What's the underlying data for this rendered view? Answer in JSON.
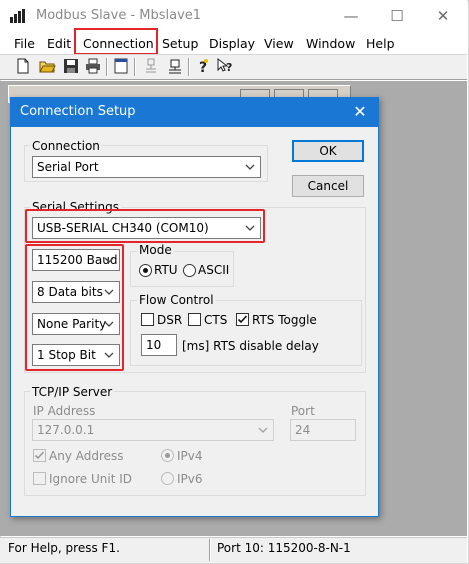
{
  "window": {
    "title": "Modbus Slave - Mbslave1",
    "minimize_glyph": "—",
    "maximize_glyph": "☐",
    "close_glyph": "✕"
  },
  "menu": [
    "File",
    "Edit",
    "Connection",
    "Setup",
    "Display",
    "View",
    "Window",
    "Help"
  ],
  "toolbar": {
    "icons": [
      "new-icon",
      "open-icon",
      "save-icon",
      "print-icon",
      "window-icon",
      "connect-icon",
      "disconnect-icon",
      "help-icon",
      "context-help-icon"
    ]
  },
  "dialog": {
    "title": "Connection Setup",
    "close_glyph": "✕",
    "connection": {
      "label": "Connection",
      "value": "Serial Port"
    },
    "ok_label": "OK",
    "cancel_label": "Cancel",
    "serial_settings": {
      "label": "Serial Settings",
      "port": "USB-SERIAL CH340 (COM10)",
      "baud": "115200 Baud",
      "data_bits": "8 Data bits",
      "parity": "None Parity",
      "stop_bits": "1 Stop Bit"
    },
    "mode": {
      "label": "Mode",
      "rtu_label": "RTU",
      "ascii_label": "ASCII",
      "selected": "RTU"
    },
    "flow_control": {
      "label": "Flow Control",
      "dsr_label": "DSR",
      "cts_label": "CTS",
      "rts_toggle_label": "RTS Toggle",
      "dsr_checked": false,
      "cts_checked": false,
      "rts_toggle_checked": true,
      "rts_delay_value": "10",
      "rts_delay_label": "[ms] RTS disable delay"
    },
    "tcpip": {
      "label": "TCP/IP Server",
      "ip_label": "IP Address",
      "ip_value": "127.0.0.1",
      "port_label": "Port",
      "port_value": "24",
      "any_address_label": "Any Address",
      "any_address_checked": true,
      "ignore_unit_id_label": "Ignore Unit ID",
      "ignore_unit_id_checked": false,
      "ipv4_label": "IPv4",
      "ipv6_label": "IPv6",
      "selected_ip_version": "IPv4"
    }
  },
  "status": {
    "left": "For Help, press F1.",
    "right": "Port 10: 115200-8-N-1"
  },
  "colors": {
    "highlight": "#e3262a",
    "dialog_title_bg": "#1a78d4",
    "mdi_background": "#ababab"
  }
}
